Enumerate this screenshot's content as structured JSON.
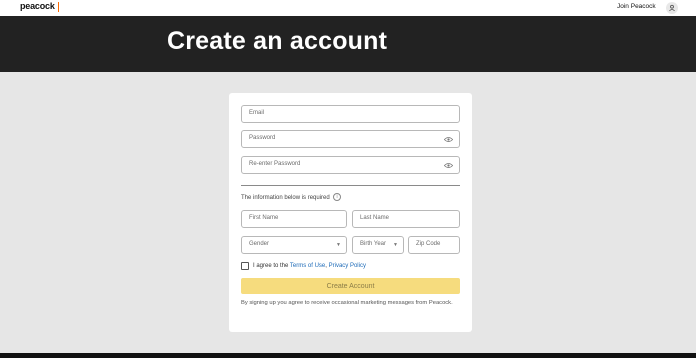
{
  "header": {
    "logo": "peacock",
    "join_label": "Join Peacock"
  },
  "hero": {
    "title": "Create an account"
  },
  "form": {
    "email_placeholder": "Email",
    "password_placeholder": "Password",
    "reenter_placeholder": "Re-enter Password",
    "required_note": "The information below is required",
    "first_name_placeholder": "First Name",
    "last_name_placeholder": "Last Name",
    "gender_placeholder": "Gender",
    "birth_year_placeholder": "Birth Year",
    "zip_placeholder": "Zip Code",
    "agree_prefix": "I agree to the ",
    "terms_link": "Terms of Use",
    "comma": ", ",
    "privacy_link": "Privacy Policy",
    "agree_checked": false,
    "submit_label": "Create Account",
    "footnote": "By signing up you agree to receive occasional marketing messages from Peacock."
  },
  "colors": {
    "hero_bg": "#222222",
    "button_bg": "#f6dc7e",
    "link": "#1e6bb8",
    "logo_accent": "#ff6a00"
  },
  "icons": {
    "avatar": "user-icon",
    "password_toggle": "eye-icon",
    "info": "info-icon",
    "select": "chevron-down-icon"
  }
}
